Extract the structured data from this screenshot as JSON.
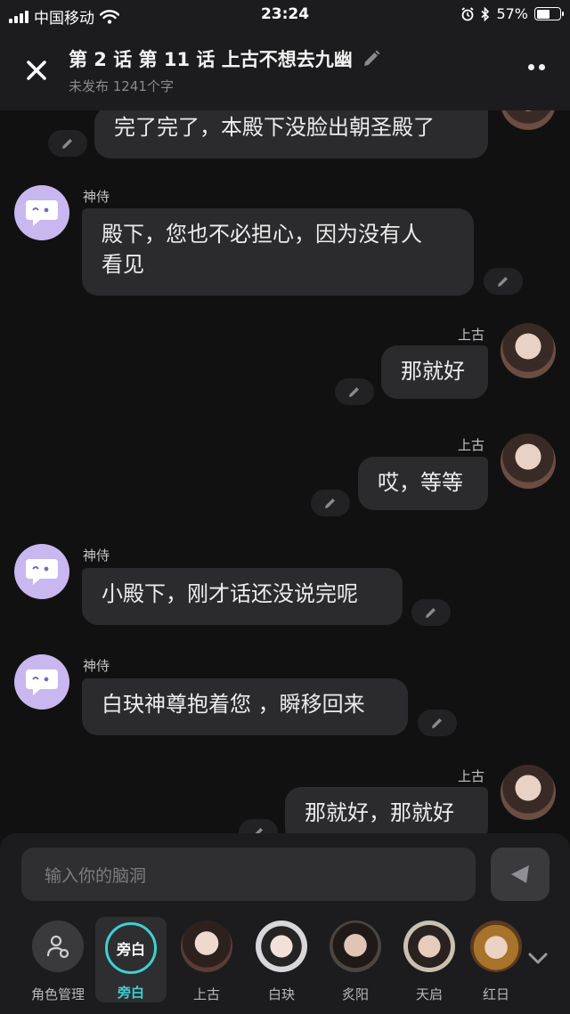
{
  "status_bar": {
    "carrier": "中国移动",
    "time": "23:24",
    "battery": "57%",
    "battery_level": 0.57
  },
  "header": {
    "title": "第 2 话 第 11 话 上古不想去九幽",
    "subtitle": "未发布 1241个字"
  },
  "messages": [
    {
      "side": "right",
      "speaker": "",
      "text": "完了完了，本殿下没脸出朝圣殿了"
    },
    {
      "side": "left",
      "speaker": "神侍",
      "text_line1": "殿下，您也不必担心，因为没有人",
      "text_line2": "看见"
    },
    {
      "side": "right",
      "speaker": "上古",
      "text": "那就好"
    },
    {
      "side": "right",
      "speaker": "上古",
      "text": "哎，等等"
    },
    {
      "side": "left",
      "speaker": "神侍",
      "text": "小殿下，刚才话还没说完呢"
    },
    {
      "side": "left",
      "speaker": "神侍",
      "text": "白玦神尊抱着您 ，瞬移回来"
    },
    {
      "side": "right",
      "speaker": "上古",
      "text": "那就好，那就好"
    }
  ],
  "input": {
    "placeholder": "输入你的脑洞"
  },
  "roles": [
    {
      "name": "角色管理",
      "icon": "role-manage-icon"
    },
    {
      "name": "旁白",
      "badge": "旁白",
      "selected": true,
      "accent": "#3fd0d3"
    },
    {
      "name": "上古"
    },
    {
      "name": "白玦"
    },
    {
      "name": "炙阳"
    },
    {
      "name": "天启"
    },
    {
      "name": "红日"
    }
  ],
  "colors": {
    "background": "#111112",
    "bubble": "#2b2b2d",
    "bot_avatar": "#c9b7ef",
    "accent": "#3fd0d3"
  }
}
